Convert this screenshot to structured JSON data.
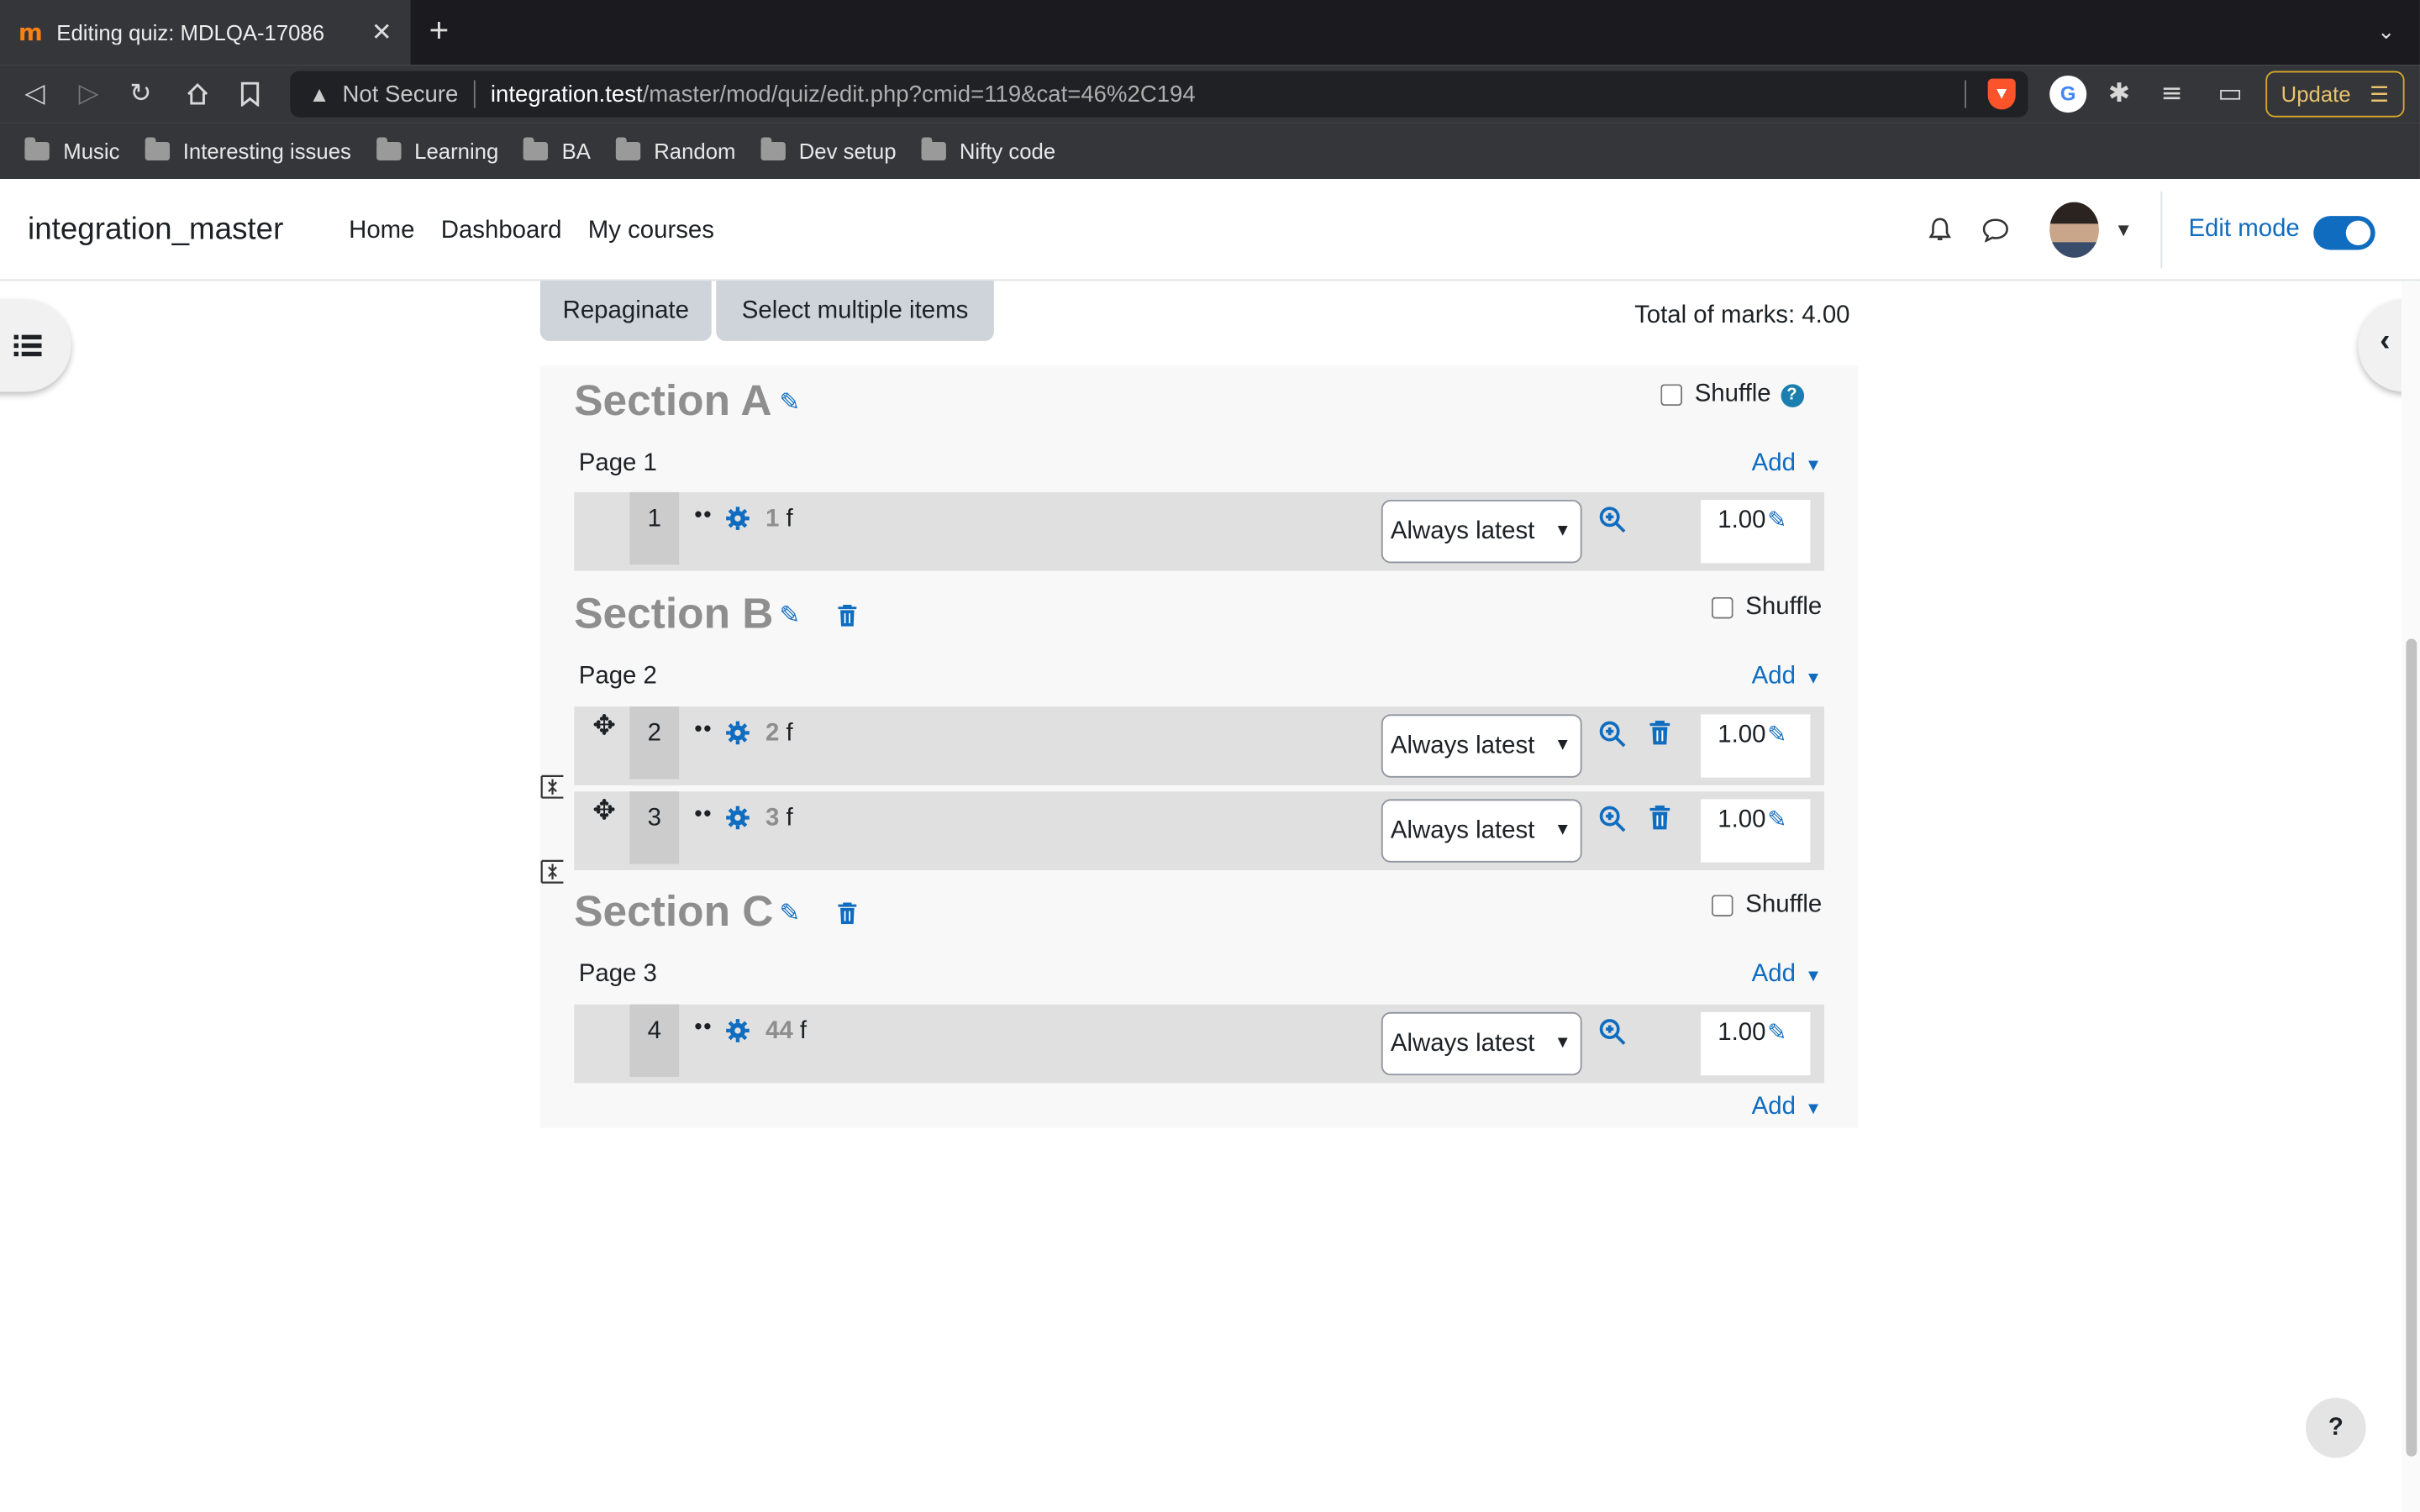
{
  "browser": {
    "tab_title": "Editing quiz: MDLQA-17086",
    "not_secure": "Not Secure",
    "url_host": "integration.test",
    "url_path": "/master/mod/quiz/edit.php?cmid=119&cat=46%2C194",
    "update_label": "Update",
    "bookmarks": [
      "Music",
      "Interesting issues",
      "Learning",
      "BA",
      "Random",
      "Dev setup",
      "Nifty code"
    ]
  },
  "navbar": {
    "site_name": "integration_master",
    "links": [
      "Home",
      "Dashboard",
      "My courses"
    ],
    "edit_mode_label": "Edit mode"
  },
  "toolbar": {
    "repaginate": "Repaginate",
    "select_multiple": "Select multiple items",
    "total_marks": "Total of marks: 4.00"
  },
  "sections": {
    "a": {
      "title": "Section A",
      "shuffle": "Shuffle",
      "page": "Page 1",
      "add": "Add",
      "q1": {
        "num": "1",
        "name": "1",
        "suffix": "f",
        "version": "Always latest",
        "mark": "1.00"
      }
    },
    "b": {
      "title": "Section B",
      "shuffle": "Shuffle",
      "page": "Page 2",
      "add": "Add",
      "q2": {
        "num": "2",
        "name": "2",
        "suffix": "f",
        "version": "Always latest",
        "mark": "1.00"
      },
      "q3": {
        "num": "3",
        "name": "3",
        "suffix": "f",
        "version": "Always latest",
        "mark": "1.00"
      }
    },
    "c": {
      "title": "Section C",
      "shuffle": "Shuffle",
      "page": "Page 3",
      "add": "Add",
      "q4": {
        "num": "4",
        "name": "44",
        "suffix": "f",
        "version": "Always latest",
        "mark": "1.00"
      }
    },
    "final_add": "Add"
  },
  "help_label": "?"
}
